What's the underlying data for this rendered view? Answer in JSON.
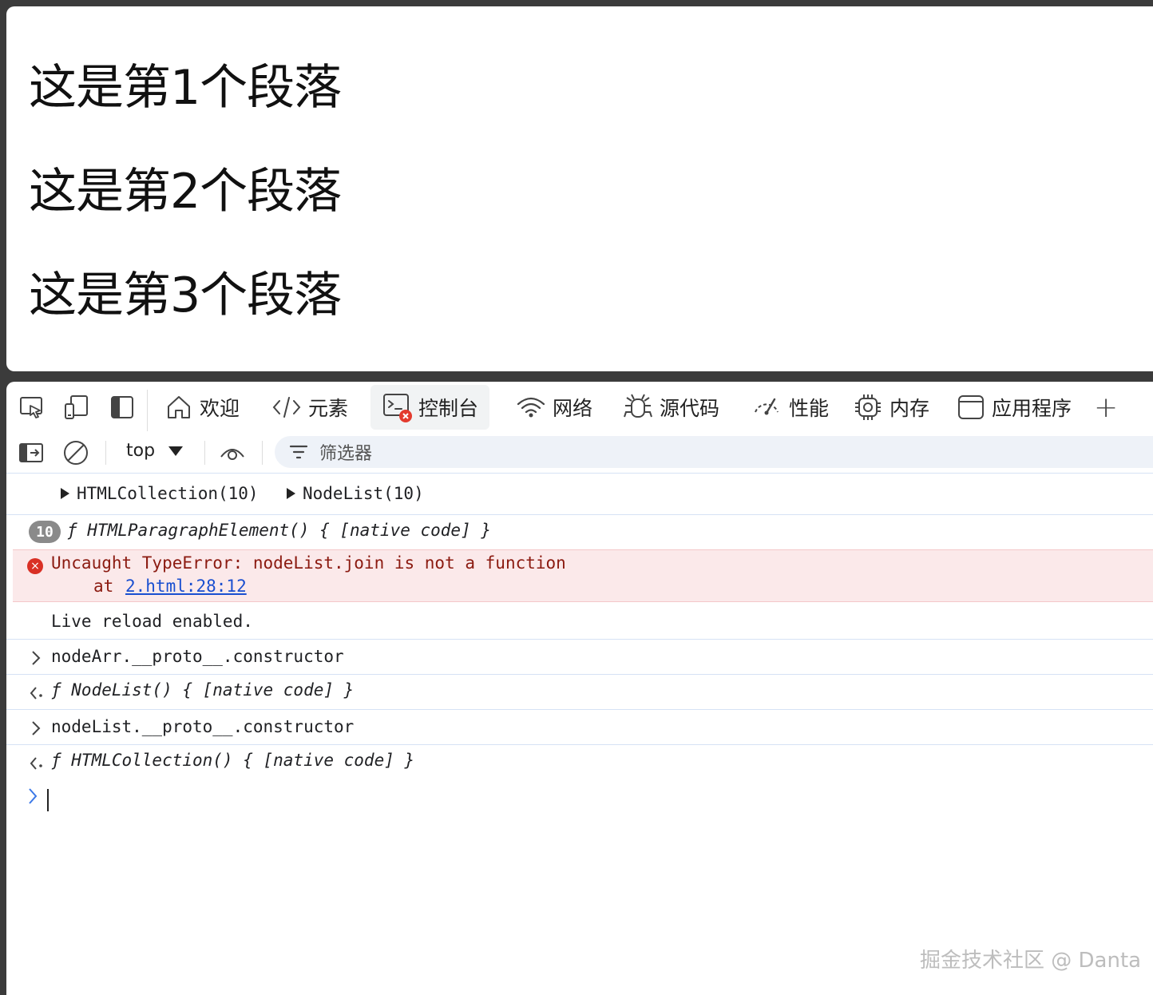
{
  "page": {
    "paragraphs": [
      "这是第1个段落",
      "这是第2个段落",
      "这是第3个段落"
    ]
  },
  "devtools": {
    "tabs": [
      {
        "label": "欢迎",
        "icon": "home-icon"
      },
      {
        "label": "元素",
        "icon": "code-icon"
      },
      {
        "label": "控制台",
        "icon": "console-icon"
      },
      {
        "label": "网络",
        "icon": "wifi-icon"
      },
      {
        "label": "源代码",
        "icon": "bug-icon"
      },
      {
        "label": "性能",
        "icon": "gauge-icon"
      },
      {
        "label": "内存",
        "icon": "chip-icon"
      },
      {
        "label": "应用程序",
        "icon": "app-window-icon"
      }
    ],
    "active_tab": "控制台",
    "add_tab": "+",
    "toolbar": {
      "context": "top",
      "filter_placeholder": "筛选器"
    }
  },
  "console": {
    "collection_a": "HTMLCollection(10)",
    "collection_b": "NodeList(10)",
    "repeat_count": "10",
    "repeat_text": "ƒ HTMLParagraphElement() { [native code] }",
    "error_message": "Uncaught TypeError: nodeList.join is not a function",
    "error_at": "at ",
    "error_link": "2.html:28:12",
    "log_live": "Live reload enabled.",
    "input1": "nodeArr.__proto__.constructor",
    "output1": "ƒ NodeList() { [native code] }",
    "input2": "nodeList.__proto__.constructor",
    "output2": "ƒ HTMLCollection() { [native code] }"
  },
  "watermark": "掘金技术社区 @ Danta"
}
